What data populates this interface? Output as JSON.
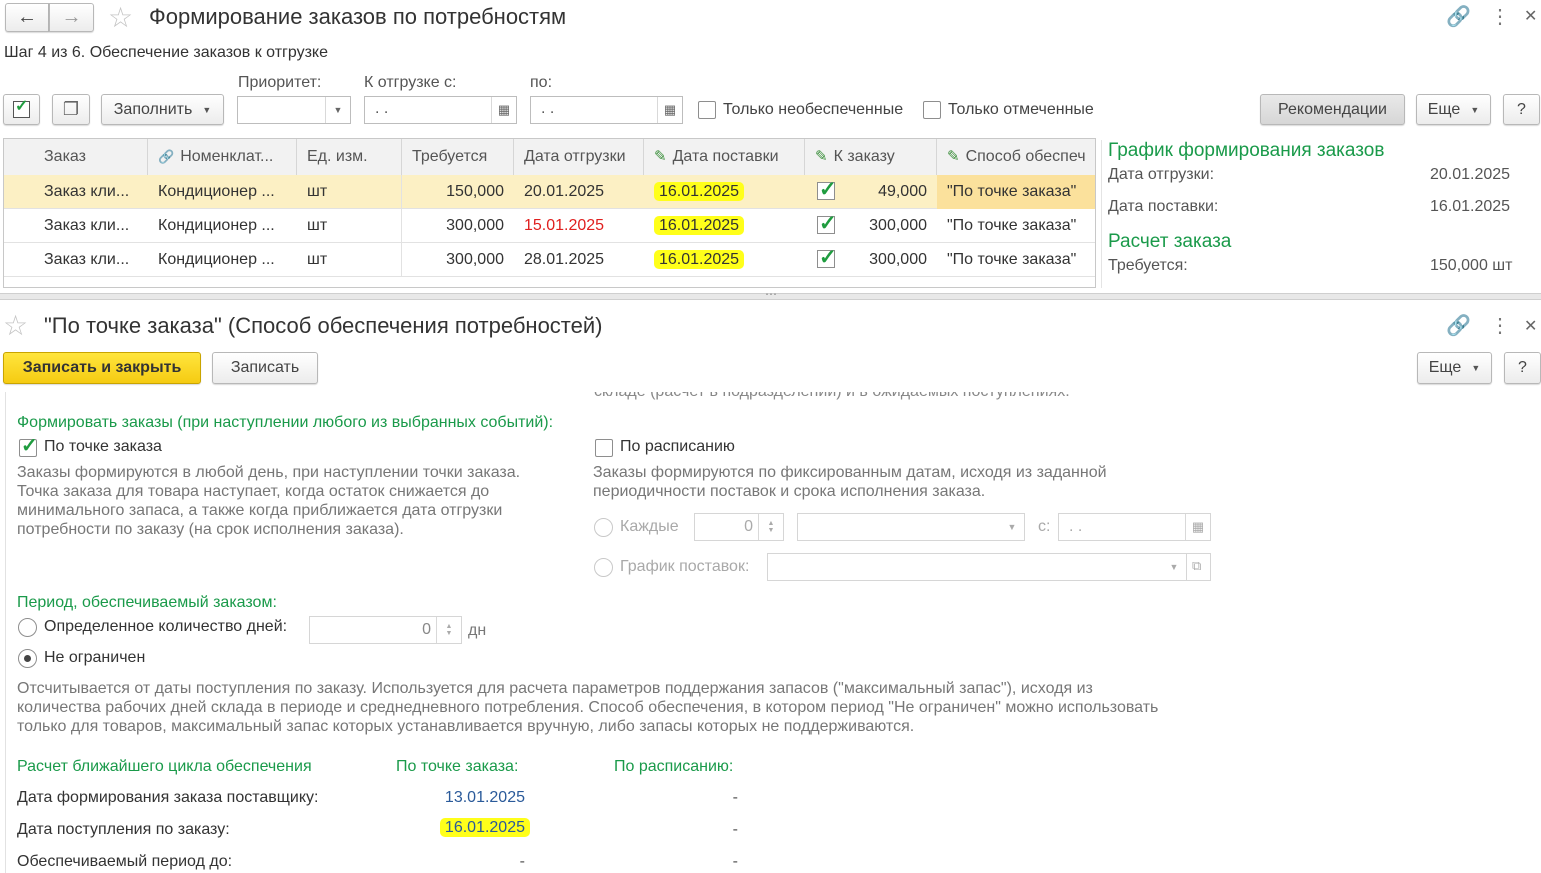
{
  "window1": {
    "back_icon": "arrow-left-icon",
    "forward_icon": "arrow-right-icon",
    "title": "Формирование заказов по потребностям",
    "step": "Шаг 4 из 6. Обеспечение заказов к отгрузке",
    "toolbar": {
      "fill_label": "Заполнить",
      "priority_label": "Приоритет:",
      "priority_value": "",
      "ship_from_label": "К отгрузке с:",
      "ship_from_value": " .  .",
      "to_label": "по:",
      "to_value": " .  .",
      "only_unsecured": "Только необеспеченные",
      "only_marked": "Только отмеченные",
      "recommendations": "Рекомендации",
      "more": "Еще",
      "help": "?"
    },
    "table": {
      "columns": [
        "Заказ",
        "Номенклат...",
        "Ед. изм.",
        "Требуется",
        "Дата отгрузки",
        "Дата поставки",
        "К заказу",
        "Способ обеспеч"
      ],
      "rows": [
        {
          "order": "Заказ кли...",
          "item": "Кондиционер ...",
          "unit": "шт",
          "required": "150,000",
          "ship_date": "20.01.2025",
          "ship_date_color": "#333333",
          "delivery": "16.01.2025",
          "checked": true,
          "to_order": "49,000",
          "method": "\"По точке заказа\""
        },
        {
          "order": "Заказ кли...",
          "item": "Кондиционер ...",
          "unit": "шт",
          "required": "300,000",
          "ship_date": "15.01.2025",
          "ship_date_color": "#e0201f",
          "delivery": "16.01.2025",
          "checked": true,
          "to_order": "300,000",
          "method": "\"По точке заказа\""
        },
        {
          "order": "Заказ кли...",
          "item": "Кондиционер ...",
          "unit": "шт",
          "required": "300,000",
          "ship_date": "28.01.2025",
          "ship_date_color": "#333333",
          "delivery": "16.01.2025",
          "checked": true,
          "to_order": "300,000",
          "method": "\"По точке заказа\""
        }
      ]
    },
    "side": {
      "schedule_title": "График формирования заказов",
      "ship_date_label": "Дата отгрузки:",
      "ship_date_value": "20.01.2025",
      "delivery_date_label": "Дата поставки:",
      "delivery_date_value": "16.01.2025",
      "calc_title": "Расчет заказа",
      "required_label": "Требуется:",
      "required_value": "150,000 шт"
    }
  },
  "window2": {
    "title": "\"По точке заказа\" (Способ обеспечения потребностей)",
    "save_close": "Записать и закрыть",
    "save": "Записать",
    "more": "Еще",
    "help": "?",
    "cut_text": "складе (расчет в подразделении) и в ожидаемых поступлениях.",
    "form_orders_label": "Формировать заказы (при наступлении любого из выбранных событий):",
    "by_point_label": "По точке заказа",
    "by_point_desc": [
      "Заказы формируются в любой день, при наступлении точки заказа.",
      "Точка заказа для товара  наступает, когда остаток снижается до",
      "минимального запаса, а также когда приближается дата отгрузки",
      "потребности по заказу (на срок исполнения заказа)."
    ],
    "by_schedule_label": "По расписанию",
    "by_schedule_desc": [
      "Заказы формируются по фиксированным датам, исходя из заданной",
      "периодичности поставок и срока исполнения заказа."
    ],
    "every_label": "Каждые",
    "every_value": "0",
    "from_label": "с:",
    "from_value": " .  .",
    "delivery_schedule_label": "График поставок:",
    "period_label": "Период, обеспечиваемый заказом:",
    "fixed_days_label": "Определенное количество дней:",
    "fixed_days_value": "0",
    "days_unit": "дн",
    "unlimited_label": "Не ограничен",
    "unlimited_desc": [
      "Отсчитывается от даты поступления по заказу. Используется для расчета параметров поддержания запасов (\"максимальный запас\"), исходя из",
      "количества рабочих дней склада в периоде и среднедневного потребления. Способ обеспечения, в котором период \"Не ограничен\" можно использовать",
      "только для товаров, максимальный запас которых устанавливается вручную, либо запасы которых не поддерживаются."
    ],
    "cycle": {
      "title": "Расчет ближайшего цикла обеспечения",
      "col_point": "По точке заказа:",
      "col_schedule": "По расписанию:",
      "rows": [
        {
          "label": "Дата формирования заказа поставщику:",
          "point": "13.01.2025",
          "schedule": "-"
        },
        {
          "label": "Дата поступления по заказу:",
          "point": "16.01.2025",
          "schedule": "-"
        },
        {
          "label": "Обеспечиваемый период до:",
          "point": "-",
          "schedule": "-"
        }
      ]
    }
  }
}
